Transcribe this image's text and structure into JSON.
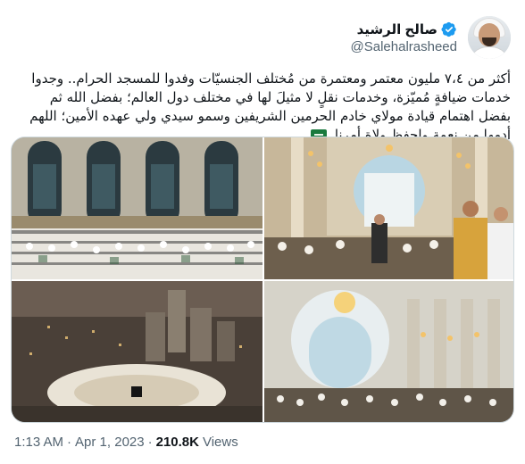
{
  "author": {
    "display_name": "صالح الرشيد",
    "handle": "@Salehalrasheed",
    "verified": true,
    "avatar_icon": "user-avatar"
  },
  "tweet": {
    "text": "أكثر من ٧،٤ مليون معتمر ومعتمرة من مُختلف الجنسيّات وفدوا للمسجد الحرام.. وجدوا خدمات ضيافةٍ مُميّزة، وخدمات نقلٍ لا مثيلَ لها في مختلف دول العالم؛ بفضل الله ثم بفضل اهتمام قيادة مولاي خادم الحرمين الشريفين وسمو سيدي ولي عهده الأمين؛ اللهم أدمها من نعمة واحفظ ولاة أمرنا",
    "flag_emoji": "saudi-arabia-flag"
  },
  "media": {
    "images": [
      {
        "name": "masjid-prayer-hall-interior"
      },
      {
        "name": "worshippers-raising-hands"
      },
      {
        "name": "makkah-aerial-night"
      },
      {
        "name": "mosque-arched-hall"
      }
    ]
  },
  "meta": {
    "time": "1:13 AM",
    "separator_1": "·",
    "date": "Apr 1, 2023",
    "separator_2": "·",
    "views_count": "210.8K",
    "views_label": "Views"
  }
}
